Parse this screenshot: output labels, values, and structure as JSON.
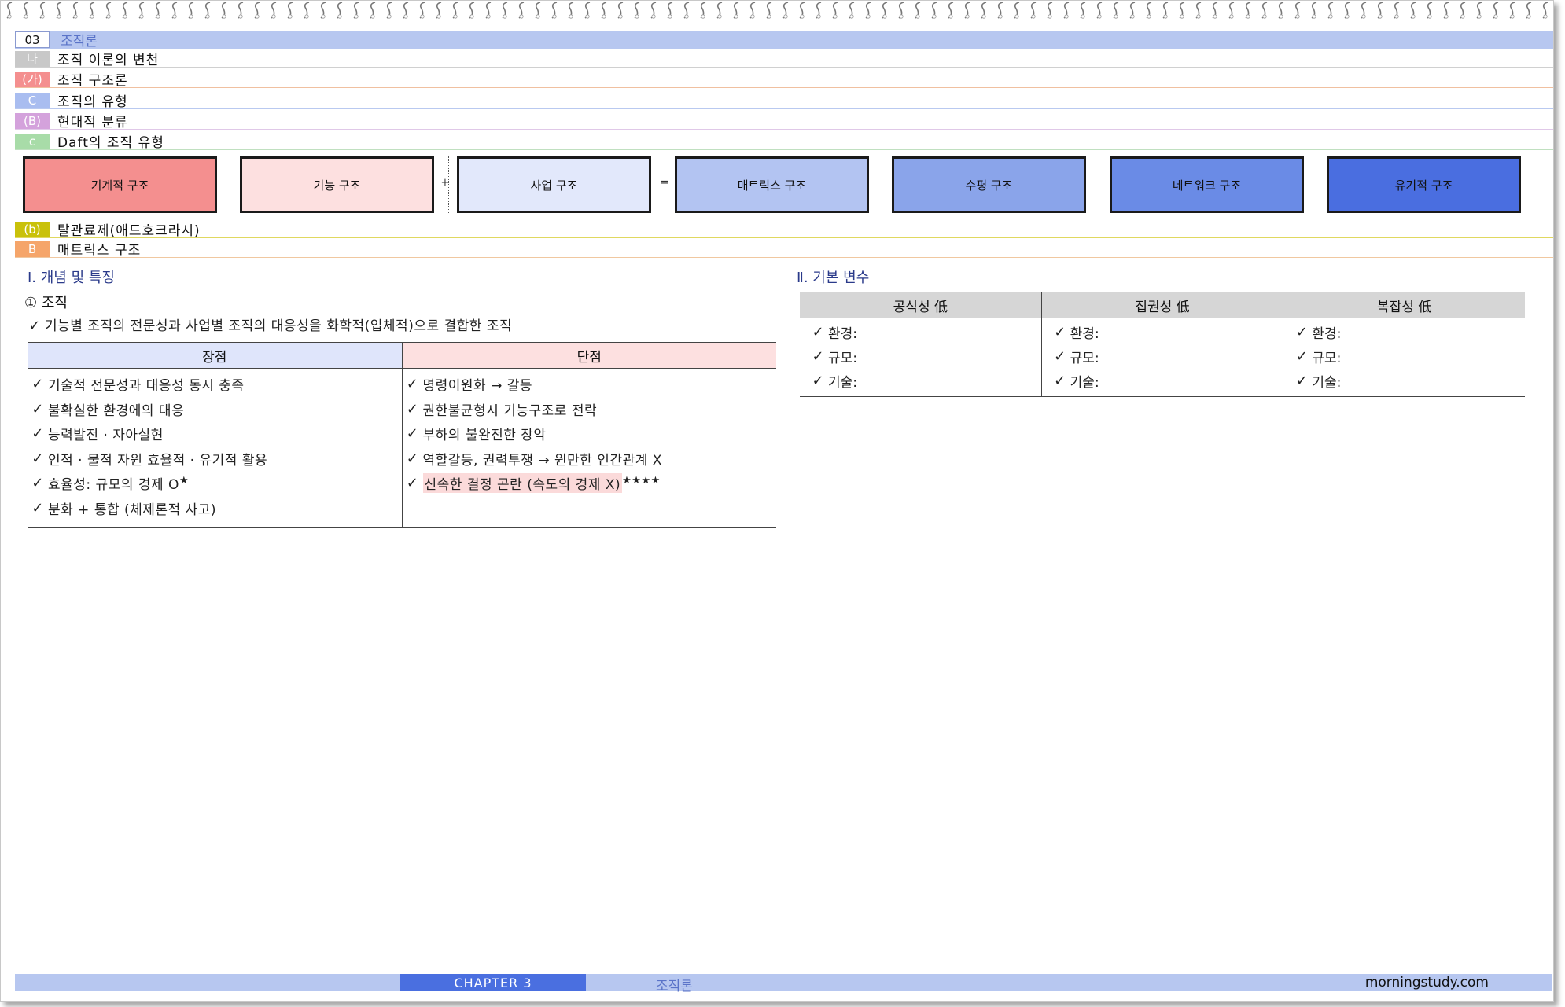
{
  "header": {
    "chapter_num": "03",
    "chapter_title": "조직론"
  },
  "breadcrumbs": [
    {
      "badge": "나",
      "label": "조직 이론의 변천",
      "color": "#c8c8c8",
      "line": "#d0d0d0"
    },
    {
      "badge": "(가)",
      "label": "조직 구조론",
      "color": "#f48f8f",
      "line": "#f0c0a0"
    },
    {
      "badge": "C",
      "label": "조직의 유형",
      "color": "#a9bdf0",
      "line": "#b9c9f0"
    },
    {
      "badge": "(B)",
      "label": "현대적 분류",
      "color": "#d4a2dc",
      "line": "#e0c8e8"
    },
    {
      "badge": "c",
      "label": "Daft의 조직 유형",
      "color": "#a8dca8",
      "line": "#c0e0c0"
    }
  ],
  "structures": [
    {
      "label": "기계적 구조",
      "color": "#f48f8f"
    },
    {
      "label": "기능 구조",
      "color": "#fde0e0"
    },
    {
      "label": "사업 구조",
      "color": "#e2e8fb"
    },
    {
      "label": "매트릭스 구조",
      "color": "#b3c4f2"
    },
    {
      "label": "수평 구조",
      "color": "#8aa4ea"
    },
    {
      "label": "네트워크 구조",
      "color": "#6a8be6"
    },
    {
      "label": "유기적 구조",
      "color": "#4a6ee0"
    }
  ],
  "operators": {
    "plus": "+",
    "equals": "="
  },
  "breadcrumbs2": [
    {
      "badge": "(b)",
      "label": "탈관료제(애드호크라시)",
      "color": "#c9c10a",
      "line": "#e0d860"
    },
    {
      "badge": "B",
      "label": "매트릭스 구조",
      "color": "#f5a56a",
      "line": "#f0c8a0"
    }
  ],
  "section1": {
    "title": "Ⅰ. 개념 및 특징",
    "sub": "① 조직",
    "check": "✓",
    "definition": "기능별 조직의 전문성과 사업별 조직의 대응성을 화학적(입체적)으로 결합한 조직",
    "pros_header": "장점",
    "cons_header": "단점",
    "pros": [
      "기술적 전문성과 대응성 동시 충족",
      "불확실한 환경에의 대응",
      "능력발전 · 자아실현",
      "인적 · 물적 자원 효율적 · 유기적 활용",
      "효율성: 규모의 경제 O",
      "분화 + 통합 (체제론적 사고)"
    ],
    "pros_star": "★",
    "cons": [
      "명령이원화 → 갈등",
      "권한불균형시 기능구조로 전락",
      "부하의 불완전한 장악",
      "역할갈등, 권력투쟁 → 원만한 인간관계 X",
      "신속한 결정 곤란 (속도의 경제 X)"
    ],
    "cons_stars": "★★★★"
  },
  "section2": {
    "title": "Ⅱ. 기본 변수",
    "headers": [
      "공식성 低",
      "집권성 低",
      "복잡성 低"
    ],
    "items": [
      "환경:",
      "규모:",
      "기술:"
    ]
  },
  "footer": {
    "chapter": "CHAPTER  3",
    "title": "조직론",
    "site": "morningstudy.com"
  }
}
